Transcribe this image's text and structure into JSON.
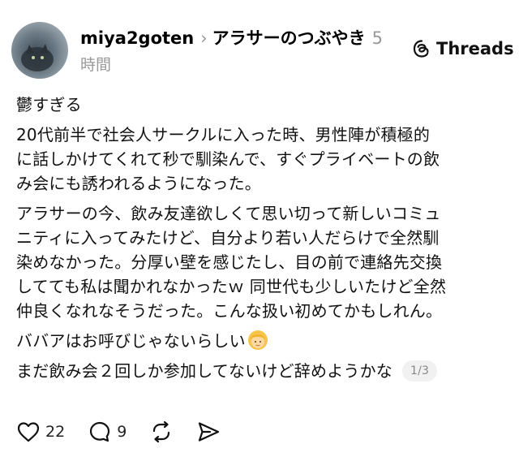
{
  "post": {
    "username": "miya2goten",
    "topic": "アラサーのつぶやき",
    "time_num": "5",
    "time_unit": "時間",
    "brand": "Threads",
    "paragraphs": [
      "鬱すぎる",
      "20代前半で社会人サークルに入った時、男性陣が積極的\nに話しかけてくれて秒で馴染んで、すぐプライベートの飲\nみ会にも誘われるようになった。",
      "アラサーの今、飲み友達欲しくて思い切って新しいコミュ\nニティに入ってみたけど、自分より若い人だらけで全然馴\n染めなかった。分厚い壁を感じたし、目の前で連絡先交換\nしてても私は聞かれなかったｗ 同世代も少しいたけど全然\n仲良くなれなそうだった。こんな扱い初めてかもしれん。"
    ],
    "paragraph_babaa": "ババアはお呼びじゃないらしい",
    "emoji_name": "woman-blond-icon",
    "last_line": "まだ飲み会２回しか参加してないけど辞めようかな",
    "page_badge": "1/3"
  },
  "actions": {
    "likes": "22",
    "replies": "9"
  },
  "colors": {
    "secondary_text": "#999999",
    "primary_text": "#111111",
    "badge_bg": "#f1f1f1"
  }
}
